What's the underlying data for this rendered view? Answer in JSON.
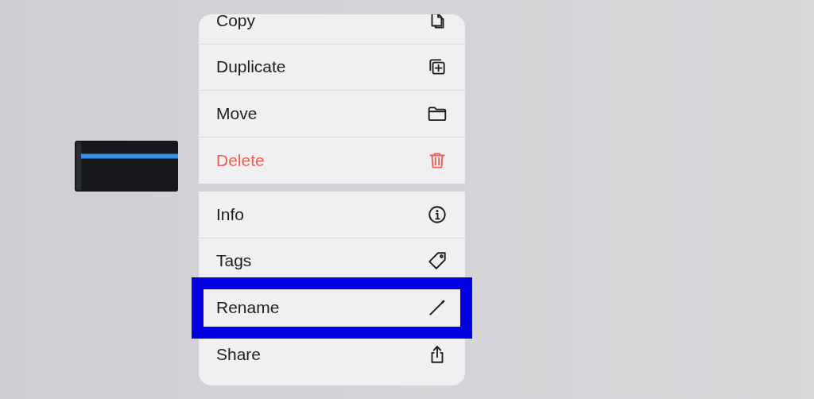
{
  "menu": {
    "sections": [
      [
        {
          "label": "Copy",
          "destructive": false,
          "highlighted": false
        },
        {
          "label": "Duplicate",
          "destructive": false,
          "highlighted": false
        },
        {
          "label": "Move",
          "destructive": false,
          "highlighted": false
        },
        {
          "label": "Delete",
          "destructive": true,
          "highlighted": false
        }
      ],
      [
        {
          "label": "Info",
          "destructive": false,
          "highlighted": false
        },
        {
          "label": "Tags",
          "destructive": false,
          "highlighted": false
        },
        {
          "label": "Rename",
          "destructive": false,
          "highlighted": true
        },
        {
          "label": "Share",
          "destructive": false,
          "highlighted": false
        }
      ]
    ]
  }
}
